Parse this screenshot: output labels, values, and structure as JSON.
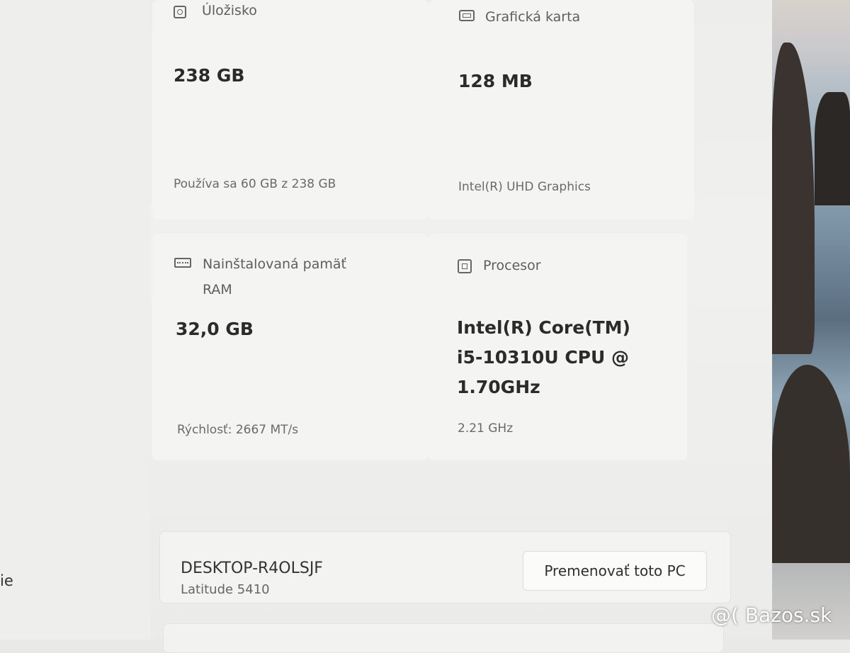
{
  "left_pane": {
    "fragment": "ie"
  },
  "specs": {
    "storage": {
      "label": "Úložisko",
      "icon": "hard-disk-icon",
      "value": "238 GB",
      "detail": "Používa sa 60 GB z 238 GB"
    },
    "gpu": {
      "label": "Grafická karta",
      "icon": "graphics-card-icon",
      "value": "128 MB",
      "detail": "Intel(R) UHD Graphics"
    },
    "ram": {
      "label_line1": "Nainštalovaná pamäť",
      "label_line2": "RAM",
      "icon": "memory-icon",
      "value": "32,0 GB",
      "detail": "Rýchlosť: 2667 MT/s"
    },
    "cpu": {
      "label": "Procesor",
      "icon": "processor-icon",
      "value": "Intel(R) Core(TM) i5-10310U CPU @ 1.70GHz",
      "detail": "2.21 GHz"
    }
  },
  "device": {
    "name": "DESKTOP-R4OLSJF",
    "model": "Latitude 5410",
    "rename_label": "Premenovať toto PC"
  },
  "watermark": "@( Bazos.sk"
}
